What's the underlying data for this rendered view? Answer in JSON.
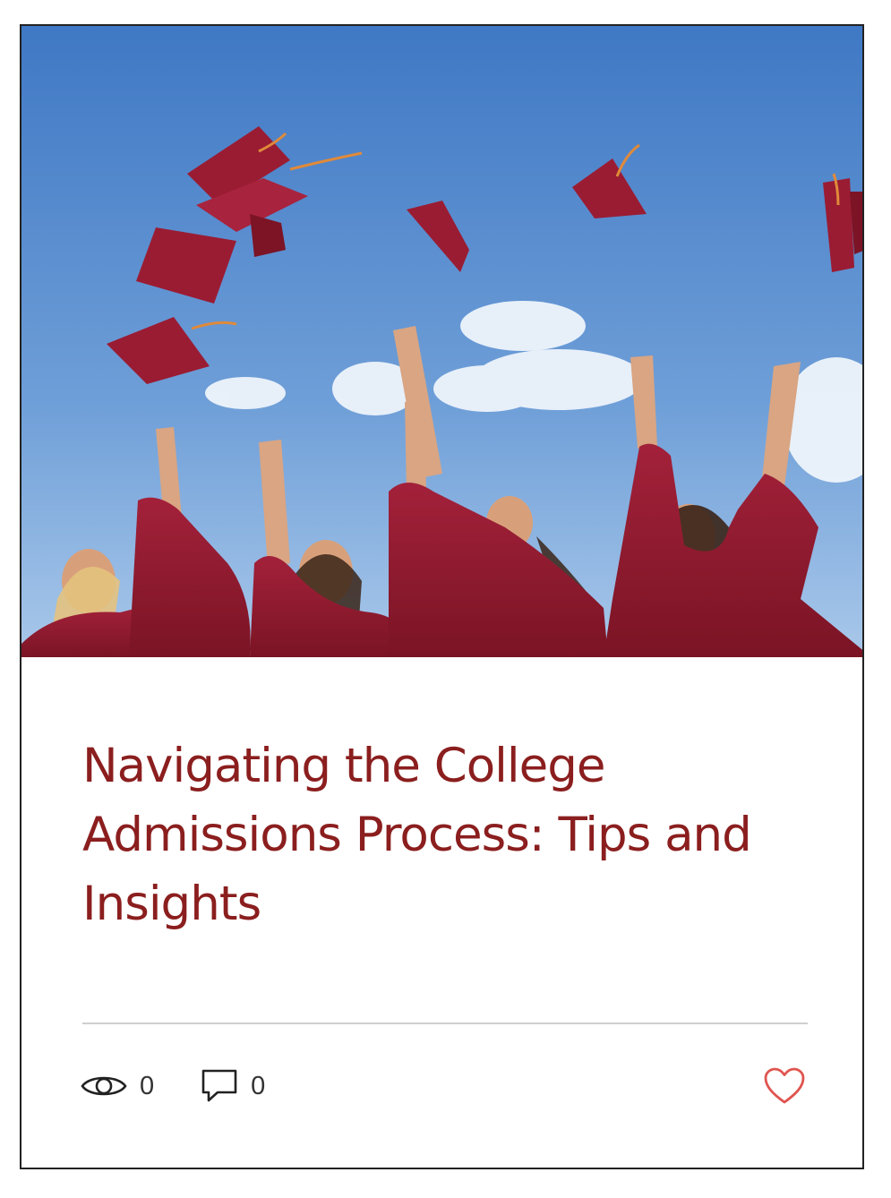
{
  "post": {
    "image_alt": "Graduates in maroon gowns tossing their caps into a blue sky",
    "title": "Navigating the College Admissions Process: Tips and Insights",
    "views": "0",
    "comments": "0",
    "liked": false
  },
  "icons": {
    "views": "eye-icon",
    "comments": "comment-icon",
    "like": "heart-icon"
  },
  "colors": {
    "title": "#8b1e1e",
    "like": "#e0544f",
    "divider": "#cfcfcf",
    "gown": "#8e1b2c",
    "sky": "#6f9fd8"
  }
}
